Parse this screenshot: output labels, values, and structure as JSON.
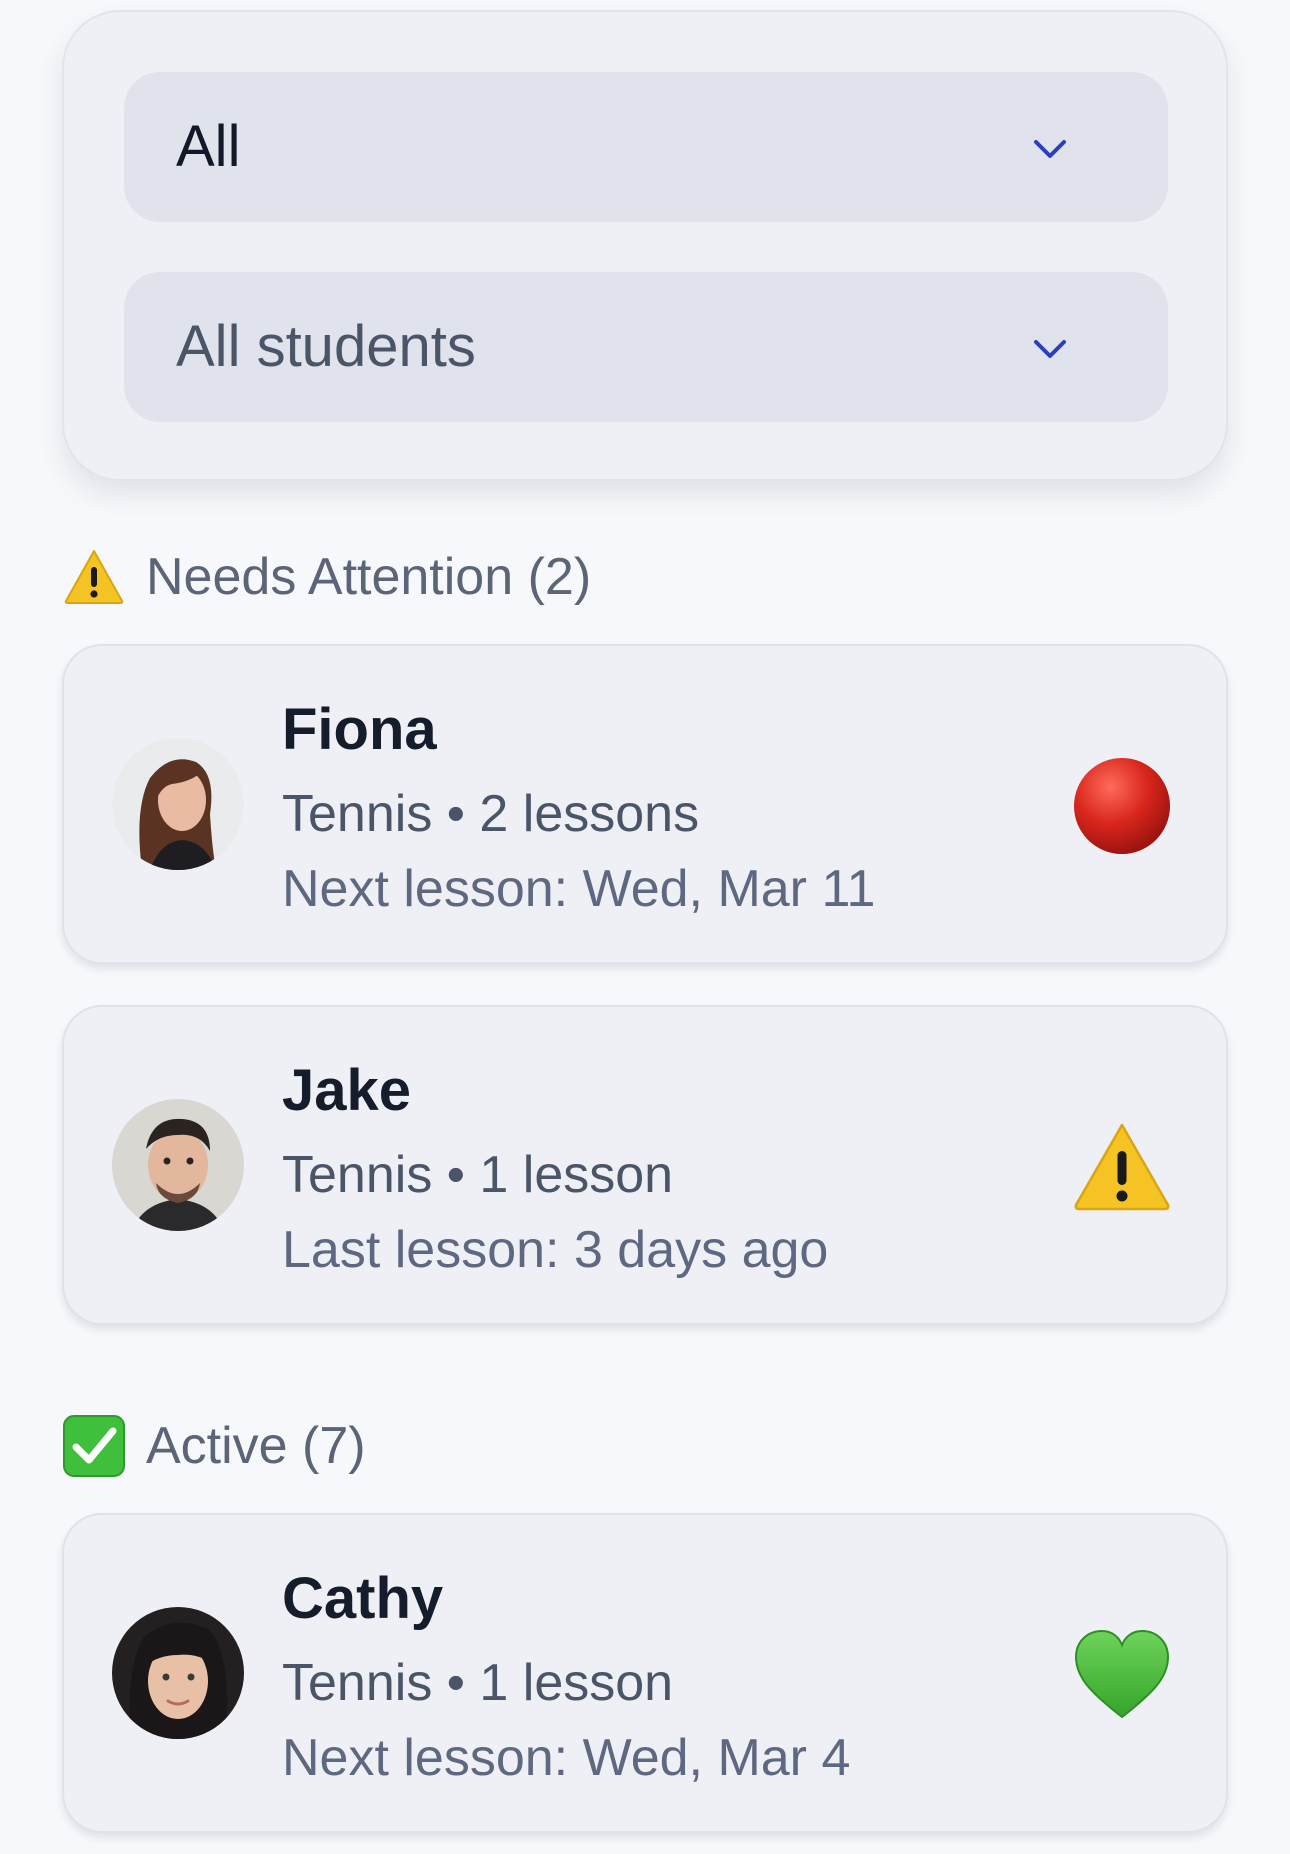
{
  "filters": {
    "primary_select": {
      "value": "All"
    },
    "student_select": {
      "value": "All students"
    }
  },
  "sections": {
    "needs_attention": {
      "label": "Needs Attention (2)",
      "icon": "warning-icon",
      "students": [
        {
          "name": "Fiona",
          "info": "Tennis • 2 lessons",
          "lesson": "Next lesson: Wed, Mar 11",
          "status_icon": "red-circle-icon",
          "status_color": "#d9261c"
        },
        {
          "name": "Jake",
          "info": "Tennis • 1 lesson",
          "lesson": "Last lesson: 3 days ago",
          "status_icon": "warning-icon",
          "status_color": "#f6c324"
        }
      ]
    },
    "active": {
      "label": "Active (7)",
      "icon": "check-box-icon",
      "students": [
        {
          "name": "Cathy",
          "info": "Tennis • 1 lesson",
          "lesson": "Next lesson: Wed, Mar 4",
          "status_icon": "green-heart-icon",
          "status_color": "#4fbf3a"
        }
      ]
    }
  },
  "colors": {
    "page_background": "#f7f8fb",
    "card_background": "#eef0f5",
    "select_background": "#e0e3eb",
    "chevron": "#2d3fbf",
    "check_green": "#3fbf3c"
  }
}
